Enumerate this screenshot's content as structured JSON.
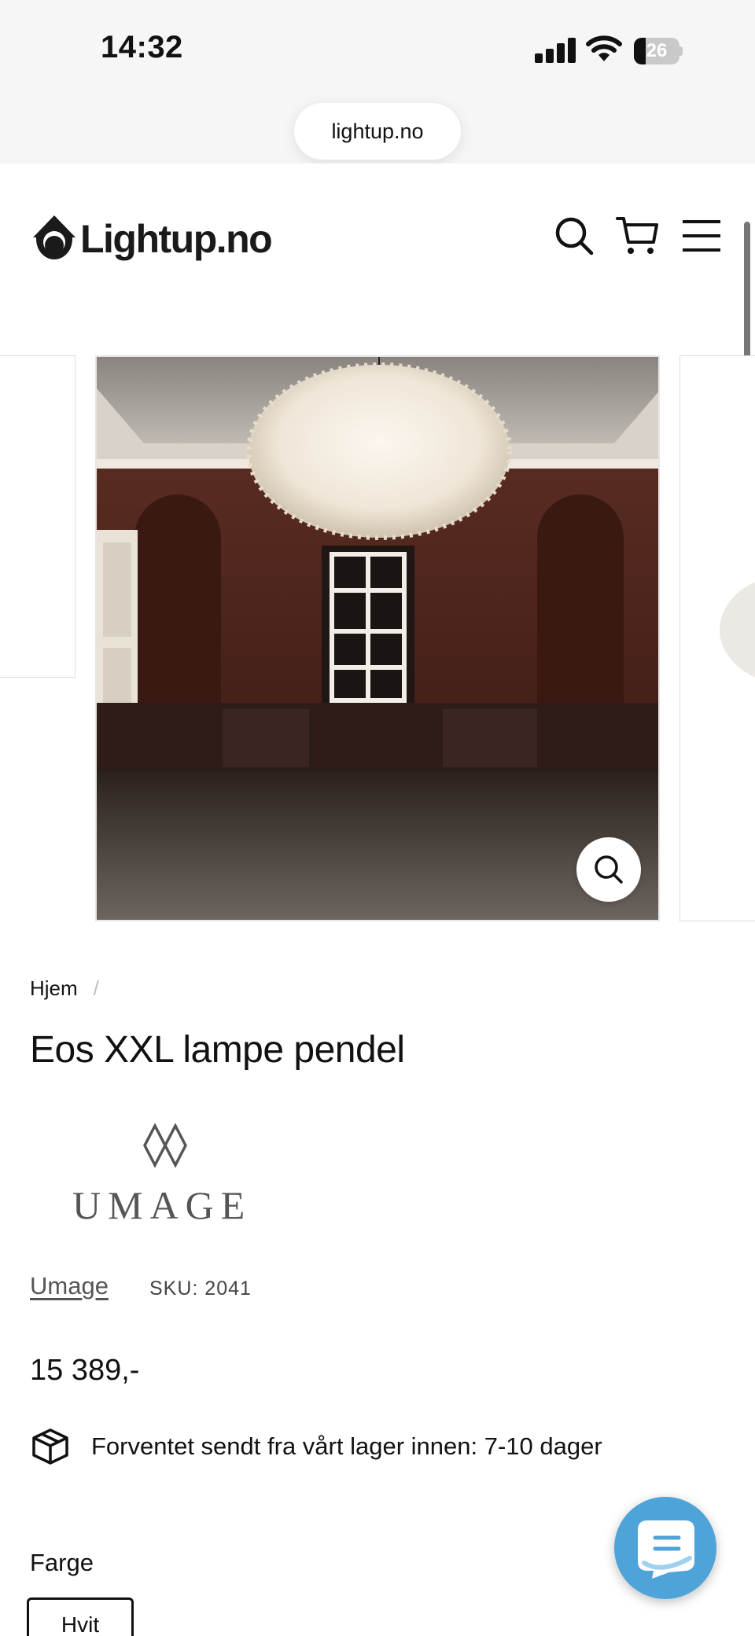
{
  "status_bar": {
    "time": "14:32",
    "battery_level": "26",
    "icons": [
      "cellular-signal-icon",
      "wifi-icon",
      "battery-icon"
    ]
  },
  "browser": {
    "url": "lightup.no"
  },
  "header": {
    "logo_text": "Lightup.no",
    "icons": [
      "search-icon",
      "cart-icon",
      "hamburger-menu-icon"
    ]
  },
  "gallery": {
    "zoom_icon": "magnifier-icon"
  },
  "product": {
    "breadcrumb": {
      "home": "Hjem",
      "separator": "/"
    },
    "title": "Eos XXL lampe pendel",
    "brand_logo_text": "UMAGE",
    "vendor": "Umage",
    "sku": "SKU: 2041",
    "price": "15 389,-",
    "shipping_note": "Forventet sendt fra vårt lager innen: 7-10 dager",
    "option_label": "Farge",
    "option_selected": "Hvit"
  },
  "colors": {
    "chat_button": "#4ea3d8",
    "text": "#111111",
    "chrome_background": "#f7f6f6"
  }
}
